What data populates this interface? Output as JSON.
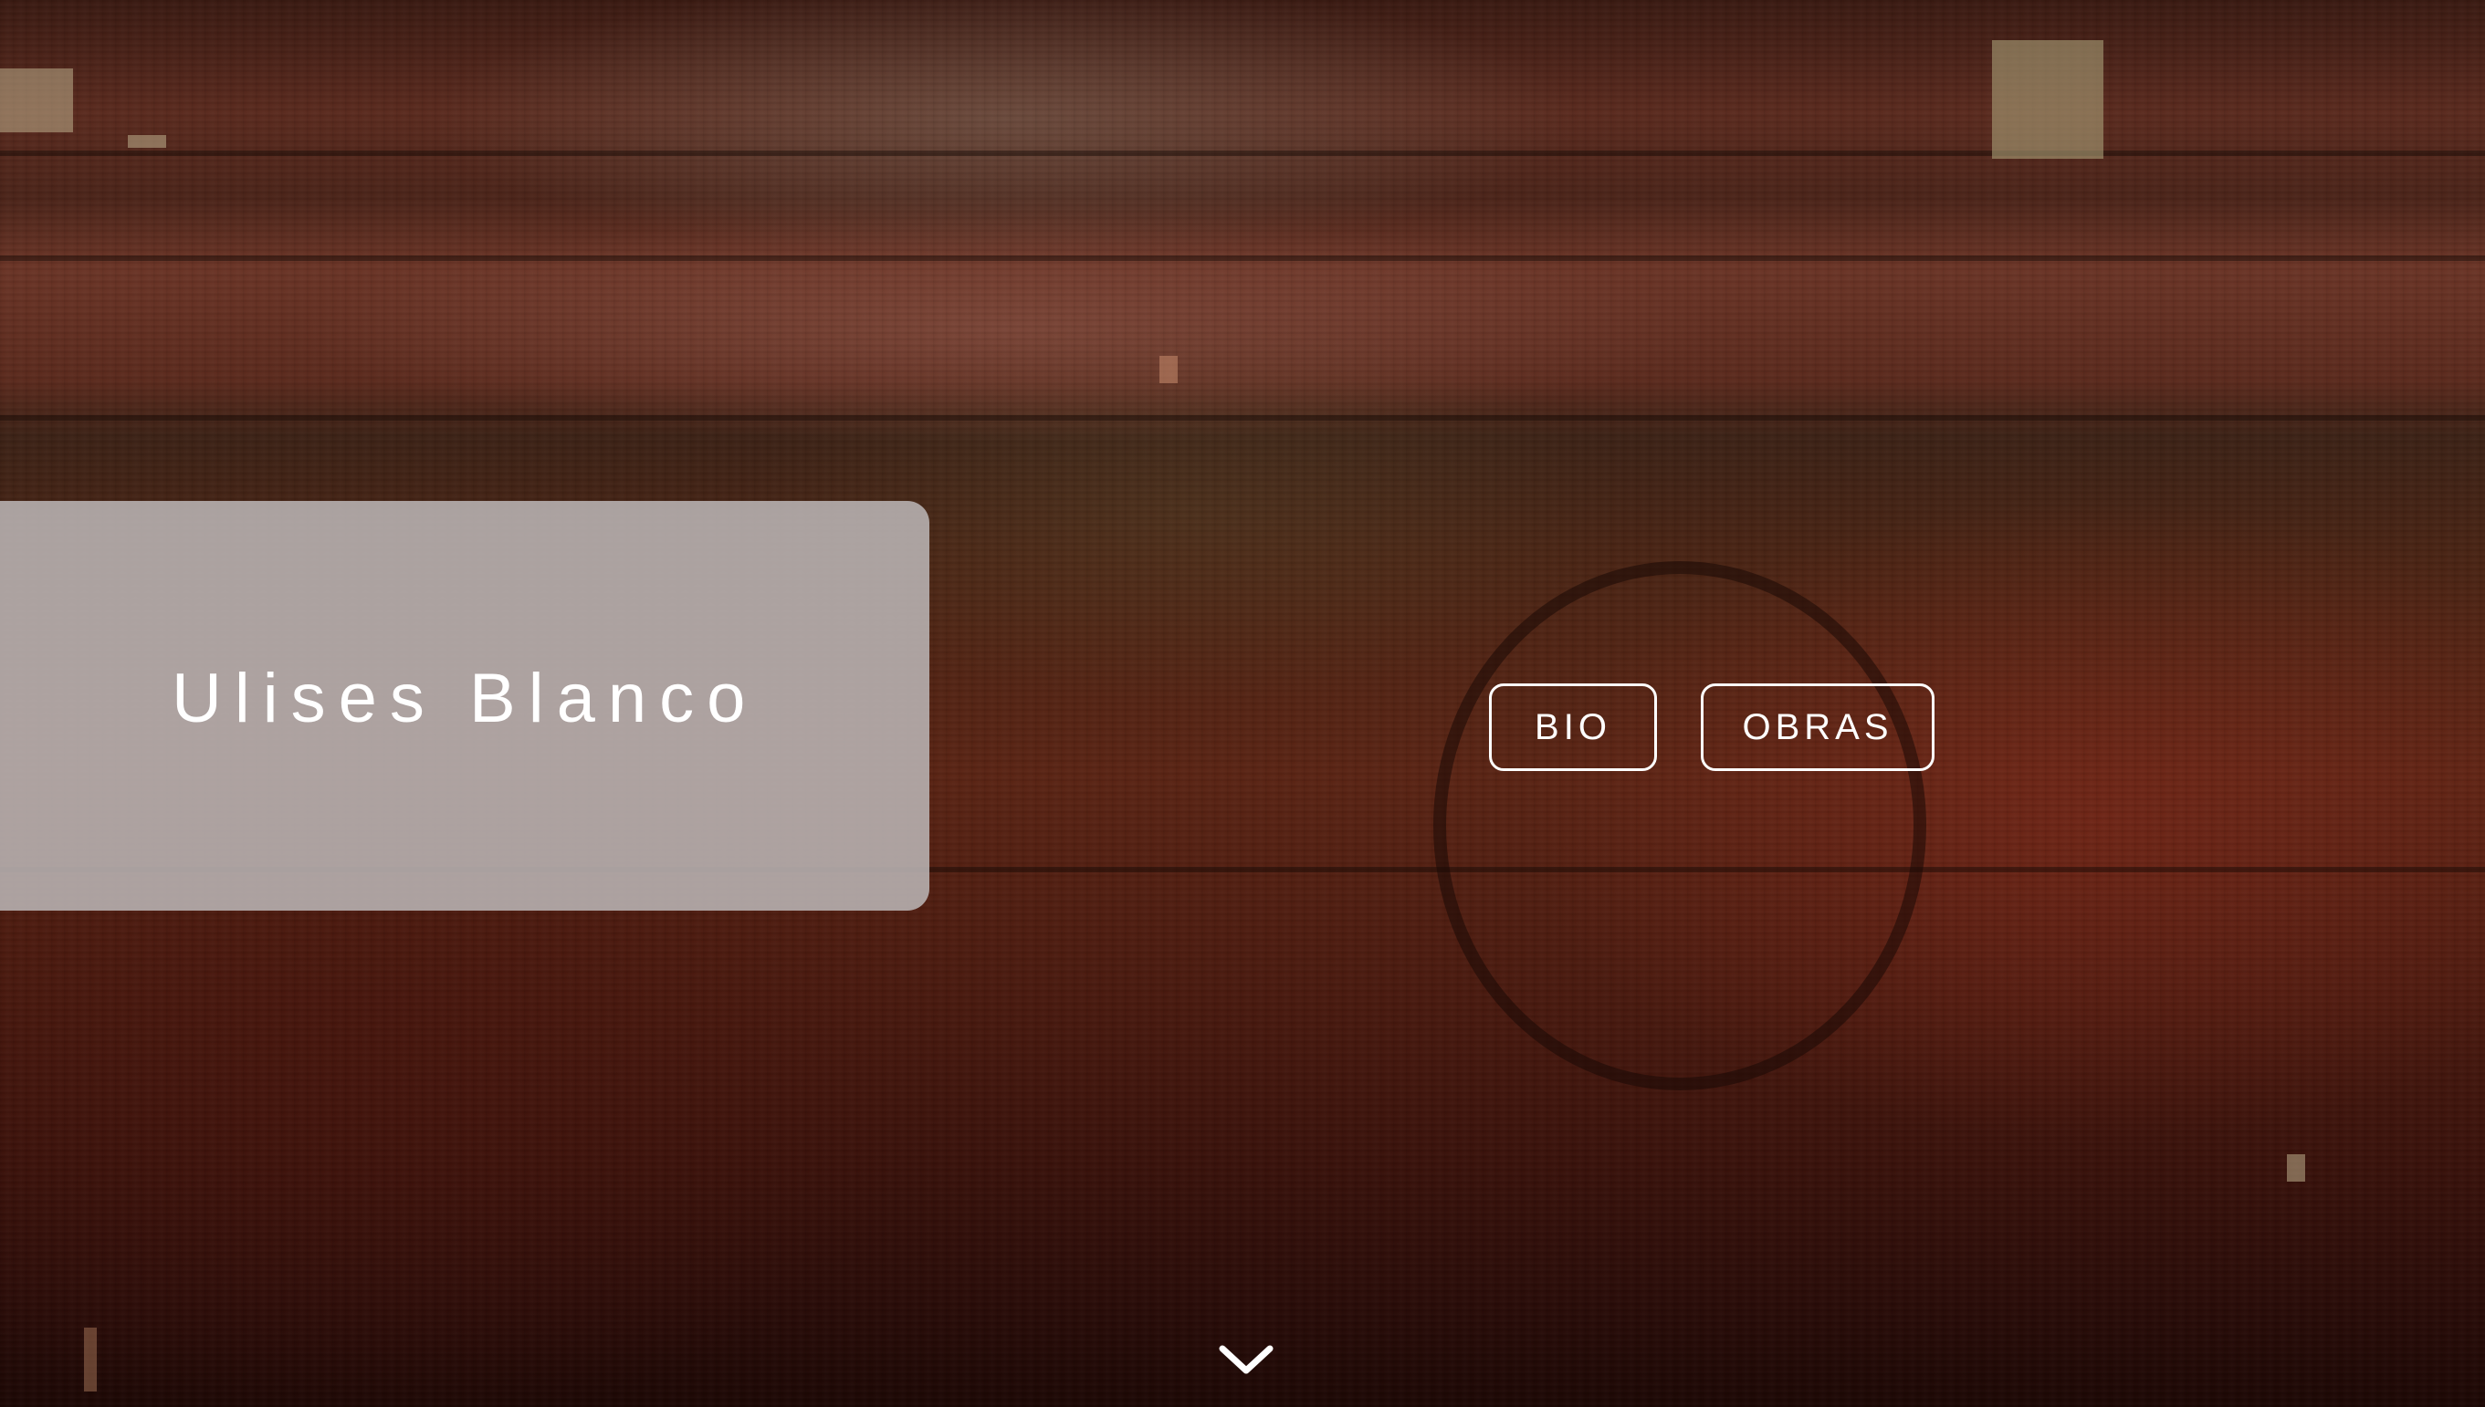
{
  "hero": {
    "title": "Ulises Blanco"
  },
  "nav": {
    "bio_label": "BIO",
    "obras_label": "OBRAS"
  },
  "icons": {
    "scroll_down": "chevron-down-icon"
  },
  "colors": {
    "title_card": "#b9b4b4",
    "text": "#ffffff",
    "background_accent": "#5a2414"
  }
}
